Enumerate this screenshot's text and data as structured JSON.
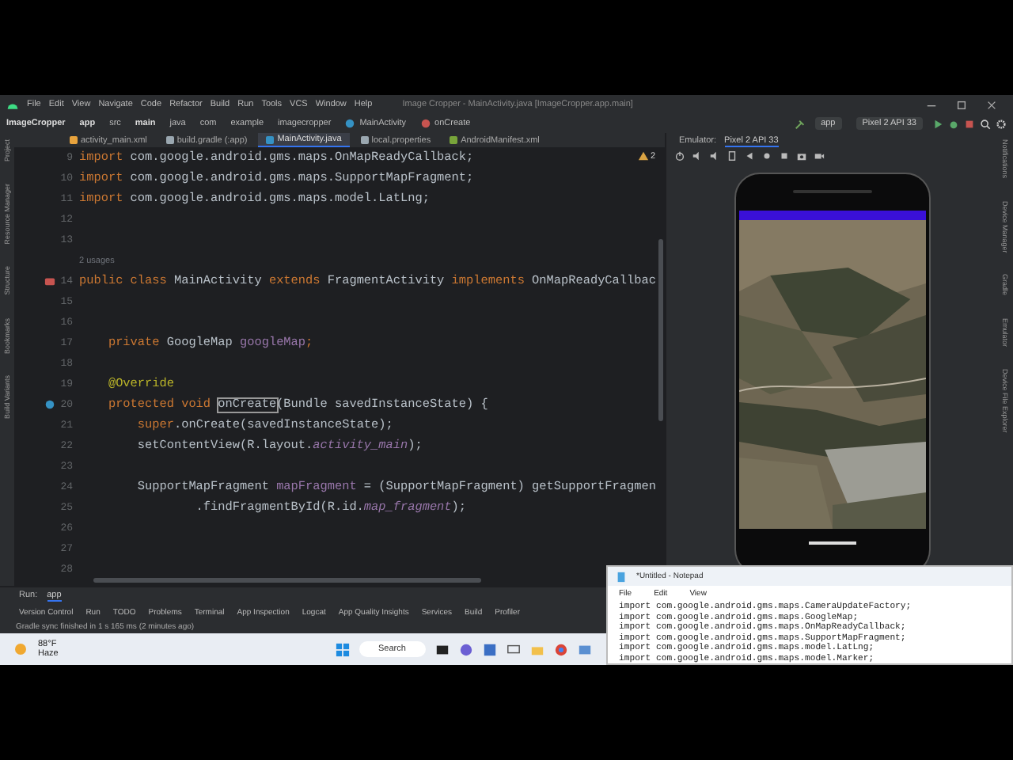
{
  "window": {
    "title": "Image Cropper - MainActivity.java [ImageCropper.app.main]"
  },
  "menu": [
    "File",
    "Edit",
    "View",
    "Navigate",
    "Code",
    "Refactor",
    "Build",
    "Run",
    "Tools",
    "VCS",
    "Window",
    "Help"
  ],
  "breadcrumbs": [
    {
      "label": "ImageCropper",
      "kind": "project"
    },
    {
      "label": "app",
      "kind": "module"
    },
    {
      "label": "src",
      "kind": "folder"
    },
    {
      "label": "main",
      "kind": "module"
    },
    {
      "label": "java",
      "kind": "folder"
    },
    {
      "label": "com",
      "kind": "folder"
    },
    {
      "label": "example",
      "kind": "folder"
    },
    {
      "label": "imagecropper",
      "kind": "folder"
    },
    {
      "label": "MainActivity",
      "kind": "class"
    },
    {
      "label": "onCreate",
      "kind": "method"
    }
  ],
  "run_toolbar": {
    "configuration": "app",
    "device": "Pixel 2 API 33"
  },
  "tabs": [
    {
      "label": "activity_main.xml",
      "kind": "xml",
      "selected": false
    },
    {
      "label": "build.gradle (:app)",
      "kind": "gradle",
      "selected": false
    },
    {
      "label": "MainActivity.java",
      "kind": "class",
      "selected": true
    },
    {
      "label": "local.properties",
      "kind": "properties",
      "selected": false
    },
    {
      "label": "AndroidManifest.xml",
      "kind": "manifest",
      "selected": false
    }
  ],
  "left_strip": [
    "Project",
    "Resource Manager",
    "Structure",
    "Bookmarks",
    "Build Variants"
  ],
  "editor": {
    "inspection_count": "2",
    "lines": [
      {
        "number": "9",
        "tokens": [
          {
            "kind": "keyword",
            "text": "import"
          },
          {
            "kind": "plain",
            "text": " com.google.android.gms.maps.OnMapReadyCallback;"
          }
        ]
      },
      {
        "number": "10",
        "tokens": [
          {
            "kind": "keyword",
            "text": "import"
          },
          {
            "kind": "plain",
            "text": " com.google.android.gms.maps.SupportMapFragment;"
          }
        ]
      },
      {
        "number": "11",
        "tokens": [
          {
            "kind": "keyword",
            "text": "import"
          },
          {
            "kind": "plain",
            "text": " com.google.android.gms.maps.model.LatLng;"
          }
        ]
      },
      {
        "number": "12"
      },
      {
        "number": "13"
      },
      {
        "kind": "inlay",
        "text": "2 usages"
      },
      {
        "number": "14",
        "kind": "class",
        "tokens": [
          {
            "kind": "keyword",
            "text": "public class"
          },
          {
            "kind": "plain",
            "text": " MainActivity "
          },
          {
            "kind": "keyword",
            "text": "extends"
          },
          {
            "kind": "plain",
            "text": " FragmentActivity "
          },
          {
            "kind": "keyword",
            "text": "implements"
          },
          {
            "kind": "plain",
            "text": " OnMapReadyCallbac"
          }
        ]
      },
      {
        "number": "15"
      },
      {
        "number": "16"
      },
      {
        "number": "17",
        "tokens": [
          {
            "kind": "keyword",
            "text": "    private"
          },
          {
            "kind": "plain",
            "text": " GoogleMap "
          },
          {
            "kind": "field",
            "text": "googleMap"
          },
          {
            "kind": "keyword",
            "text": ";"
          }
        ]
      },
      {
        "number": "18"
      },
      {
        "number": "19",
        "tokens": [
          {
            "kind": "annotation",
            "text": "    @Override"
          }
        ]
      },
      {
        "number": "20",
        "kind": "override",
        "tokens": [
          {
            "kind": "keyword",
            "text": "    protected void "
          },
          {
            "kind": "highlight",
            "text": "onCreate"
          },
          {
            "kind": "plain",
            "text": "(Bundle savedInstanceState) {"
          }
        ]
      },
      {
        "number": "21",
        "tokens": [
          {
            "kind": "keyword",
            "text": "        super"
          },
          {
            "kind": "plain",
            "text": ".onCreate(savedInstanceState);"
          }
        ]
      },
      {
        "number": "22",
        "tokens": [
          {
            "kind": "plain",
            "text": "        setContentView(R.layout."
          },
          {
            "kind": "static",
            "text": "activity_main"
          },
          {
            "kind": "plain",
            "text": ");"
          }
        ]
      },
      {
        "number": "23"
      },
      {
        "number": "24",
        "tokens": [
          {
            "kind": "plain",
            "text": "        SupportMapFragment "
          },
          {
            "kind": "field",
            "text": "mapFragment"
          },
          {
            "kind": "plain",
            "text": " = (SupportMapFragment) getSupportFragmen"
          }
        ]
      },
      {
        "number": "25",
        "tokens": [
          {
            "kind": "plain",
            "text": "                .findFragmentById(R.id."
          },
          {
            "kind": "static",
            "text": "map_fragment"
          },
          {
            "kind": "plain",
            "text": ");"
          }
        ]
      },
      {
        "number": "26"
      },
      {
        "number": "27"
      },
      {
        "number": "28"
      }
    ]
  },
  "emulator": {
    "label": "Emulator:",
    "device": "Pixel 2 API 33"
  },
  "right_strip": [
    "Notifications",
    "Device Manager",
    "Gradle",
    "Emulator",
    "Device File Explorer"
  ],
  "run_bar": {
    "label": "Run:",
    "configuration": "app"
  },
  "tool_windows": [
    "Version Control",
    "Run",
    "TODO",
    "Problems",
    "Terminal",
    "App Inspection",
    "Logcat",
    "App Quality Insights",
    "Services",
    "Build",
    "Profiler"
  ],
  "status": "Gradle sync finished in 1 s 165 ms (2 minutes ago)",
  "taskbar": {
    "temperature": "88°F",
    "weather": "Haze",
    "search": "Search"
  },
  "notepad": {
    "title": "*Untitled - Notepad",
    "menu": [
      "File",
      "Edit",
      "View"
    ],
    "lines": [
      "import com.google.android.gms.maps.CameraUpdateFactory;",
      "import com.google.android.gms.maps.GoogleMap;",
      "import com.google.android.gms.maps.OnMapReadyCallback;",
      "import com.google.android.gms.maps.SupportMapFragment;",
      "import com.google.android.gms.maps.model.LatLng;",
      "import com.google.android.gms.maps.model.Marker;"
    ]
  }
}
